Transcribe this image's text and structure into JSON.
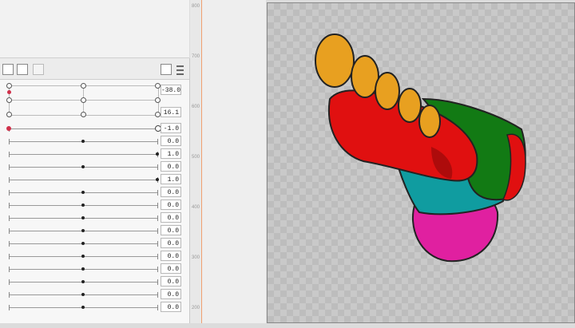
{
  "param_values": [
    "-1.0",
    "0.0",
    "1.0",
    "0.0",
    "1.0",
    "0.0",
    "0.0",
    "0.0",
    "0.0",
    "0.0",
    "0.0",
    "0.0",
    "0.0",
    "0.0",
    "0.0"
  ],
  "warp_values": [
    "-38.0",
    "16.1"
  ],
  "ruler_labels": [
    "800",
    "700",
    "600",
    "500",
    "400",
    "300",
    "200"
  ],
  "colors": {
    "toe": "#e8a020",
    "sole_red": "#e01010",
    "heel_pink": "#e020a0",
    "teal": "#109ca0",
    "green": "#127a14",
    "canvas_bg": "#c9c9c9"
  }
}
